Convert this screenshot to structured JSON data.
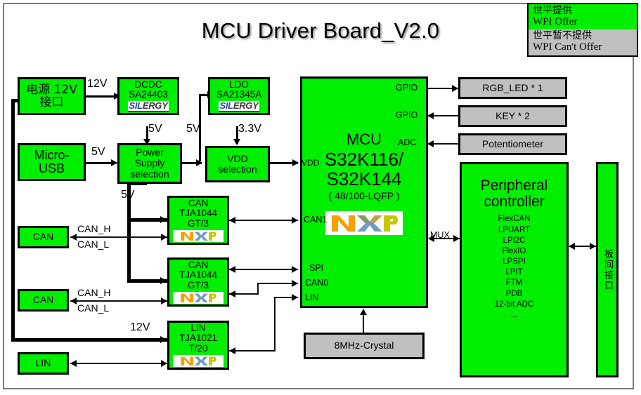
{
  "page": {
    "title": "MCU Driver Board_V2.0"
  },
  "legend": {
    "offer": {
      "cn": "世平提供",
      "en": "WPI Offer",
      "color": "#00ee00"
    },
    "not_offer": {
      "cn": "世平暂不提供",
      "en": "WPI Can't Offer",
      "color": "#c0c0c0"
    }
  },
  "blocks": {
    "power_12v": {
      "line1": "电源 12V",
      "line2": "接口"
    },
    "micro_usb": {
      "line1": "Micro-",
      "line2": "USB"
    },
    "dcdc": {
      "line1": "DCDC",
      "line2": "SA24403",
      "logo_a": "SIL",
      "logo_b": "ERGY"
    },
    "ldo": {
      "line1": "LDO",
      "line2": "SA21345A",
      "logo_a": "SIL",
      "logo_b": "ERGY"
    },
    "power_supply_selection": {
      "line1": "Power",
      "line2": "Supply",
      "line3": "selection"
    },
    "vdd_selection": {
      "line1": "VDD",
      "line2": "selection"
    },
    "mcu": {
      "line1": "MCU",
      "line2": "S32K116/",
      "line3": "S32K144",
      "line4": "( 48/100-LQFP )",
      "logo": "NXP"
    },
    "can_tx_1": {
      "line1": "CAN",
      "line2": "TJA1044",
      "line3": "GT/3",
      "logo": "NXP"
    },
    "can_tx_2": {
      "line1": "CAN",
      "line2": "TJA1044",
      "line3": "GT/3",
      "logo": "NXP"
    },
    "lin_tx": {
      "line1": "LIN",
      "line2": "TJA1021",
      "line3": "T/20",
      "logo": "NXP"
    },
    "can_conn_1": {
      "label": "CAN"
    },
    "can_conn_2": {
      "label": "CAN"
    },
    "lin_conn": {
      "label": "LIN"
    },
    "rgb_led": {
      "label": "RGB_LED * 1"
    },
    "key": {
      "label": "KEY * 2"
    },
    "potentiometer": {
      "label": "Potentiometer"
    },
    "crystal": {
      "label": "8MHz-Crystal"
    },
    "peripheral_controller": {
      "line1": "Peripheral",
      "line2": "controller",
      "items": [
        "FlexCAN",
        "LPUART",
        "LPI2C",
        "FlexIO",
        "LPSPI",
        "LPIT",
        "FTM",
        "PDB",
        "12-bit ADC",
        "..."
      ]
    },
    "board_interface": {
      "label": "板间接口"
    }
  },
  "pins": {
    "gpio_1": "GPIO",
    "gpio_2": "GPIO",
    "adc": "ADC",
    "vdd": "VDD",
    "can1": "CAN1",
    "spi": "SPI",
    "can0": "CAN0",
    "lin": "LIN",
    "mux": "MUX"
  },
  "signals": {
    "v12_a": "12V",
    "v5_dcdc": "5V",
    "v5_ldo_in": "5V",
    "v33": "3.3V",
    "v5_usb": "5V",
    "v5_psel": "5V",
    "v12_lin": "12V",
    "can_h_1": "CAN_H",
    "can_l_1": "CAN_L",
    "can_h_2": "CAN_H",
    "can_l_2": "CAN_L"
  }
}
